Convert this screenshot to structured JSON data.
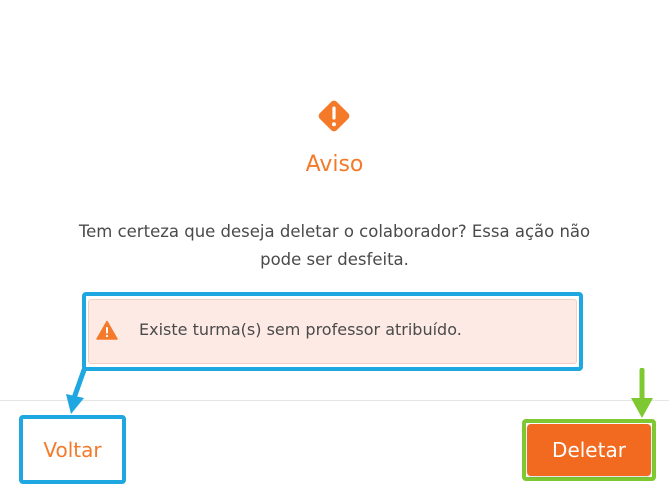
{
  "dialog": {
    "icon": "warning-diamond-icon",
    "title": "Aviso",
    "message": "Tem certeza que deseja deletar o colaborador? Essa ação não pode ser desfeita.",
    "alert": {
      "icon": "warning-triangle-icon",
      "text": "Existe turma(s) sem professor atribuído."
    },
    "buttons": {
      "back_label": "Voltar",
      "delete_label": "Deletar"
    }
  },
  "colors": {
    "accent": "#f47a2a",
    "delete_button": "#f26a1f",
    "alert_background": "#fdeae4",
    "highlight_blue": "#1ea7e1",
    "highlight_green": "#7ec832"
  },
  "annotations": [
    {
      "icon": "down-arrow-icon",
      "color": "blue"
    },
    {
      "icon": "down-arrow-icon",
      "color": "green"
    }
  ]
}
